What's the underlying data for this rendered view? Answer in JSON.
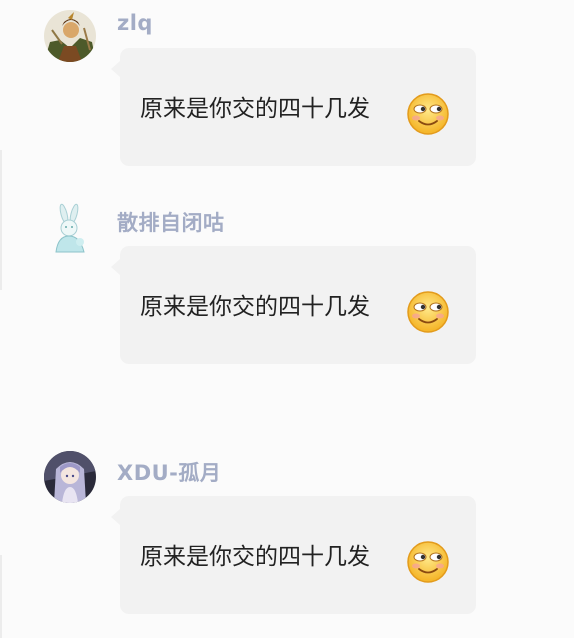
{
  "messages": [
    {
      "author": "zlq",
      "text": "原来是你交的四十几发",
      "emoji": "sly-smile-emoji",
      "avatar": "warrior-avatar"
    },
    {
      "author": "散排自闭咕",
      "text": "原来是你交的四十几发",
      "emoji": "sly-smile-emoji",
      "avatar": "rabbit-avatar"
    },
    {
      "author": "XDU-孤月",
      "text": "原来是你交的四十几发",
      "emoji": "sly-smile-emoji",
      "avatar": "anime-girl-avatar"
    }
  ],
  "colors": {
    "background": "#fbfbfb",
    "bubble": "#f2f2f2",
    "author_name": "#a3acc5",
    "text": "#222222"
  }
}
